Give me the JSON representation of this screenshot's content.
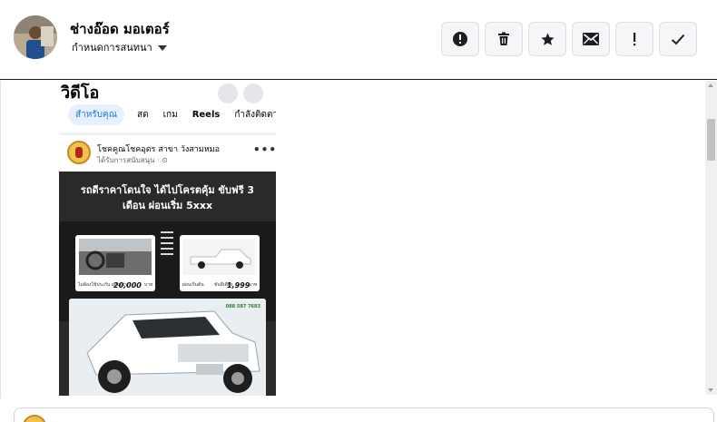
{
  "header": {
    "contact_name": "ช่างอ๊อด มอเตอร์",
    "subtitle": "กำหนดการสนทนา",
    "actions": [
      {
        "icon": "alert-circle-icon",
        "label": "!"
      },
      {
        "icon": "trash-icon"
      },
      {
        "icon": "star-icon"
      },
      {
        "icon": "envelope-icon"
      },
      {
        "icon": "exclamation-icon",
        "label": "!"
      },
      {
        "icon": "check-icon"
      }
    ]
  },
  "shot": {
    "title": "วิดีโอ",
    "tabs": [
      "สำหรับคุณ",
      "สด",
      "เกม",
      "Reels",
      "กำลังติดตาม"
    ],
    "page_name": "โชคคูณโชคอุดร สาขา วังสามหมอ",
    "sponsored": "ได้รับการสนับสนุน · ⊙",
    "more": "•••",
    "ad_headline": "รถดีราคาโดนใจ ได้ไปโครตคุ้ม ขับฟรี 3 เดือน ผ่อนเริ่ม 5xxx",
    "card1_caption": "ไม่ต้องใช้ประกัน ผ่อนเท่า",
    "card1_price": "20,000",
    "card1_unit": "บาท",
    "card2_caption": "ผ่อนเริ่มต้น",
    "card2_prefix": "ขับดีเพียง",
    "card2_price": "1,999",
    "card2_unit": "บาท",
    "phone": "088 587 7683"
  },
  "colors": {
    "accent": "#1877f2",
    "button_bg": "#f5f6f7",
    "ad_bg": "#2a2a2a"
  }
}
